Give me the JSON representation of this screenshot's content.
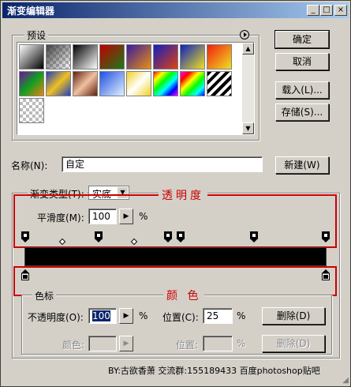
{
  "window": {
    "title": "渐变编辑器",
    "controls": [
      "_",
      "□",
      "×"
    ]
  },
  "presets": {
    "legend": "预设",
    "menu_icon": "circle-arrow-right-icon"
  },
  "buttons": {
    "ok": "确定",
    "cancel": "取消",
    "load": "载入(L)...",
    "save": "存储(S)..."
  },
  "name_row": {
    "label": "名称(N):",
    "value": "自定",
    "new_button": "新建(W)"
  },
  "gradient_type": {
    "label": "渐变类型(T):",
    "value": "实底"
  },
  "smoothness": {
    "label": "平滑度(M):",
    "value": "100",
    "unit": "%"
  },
  "annotations": {
    "transparency": "透明度",
    "color": "颜 色"
  },
  "stops_group": {
    "legend": "色标",
    "opacity_label": "不透明度(O):",
    "opacity_value": "100",
    "opacity_unit": "%",
    "location_label_1": "位置(C):",
    "location_value_1": "25",
    "location_unit_1": "%",
    "delete_1": "删除(D)",
    "color_label": "颜色:",
    "location_label_2": "位置:",
    "location_unit_2": "%",
    "delete_2": "删除(D)"
  },
  "footer": {
    "credit": "BY:古欲香萧   交流群:155189433   百度photoshop贴吧"
  },
  "colors": {
    "title_start": "#0a246a",
    "title_end": "#a6caf0",
    "annotation_red": "#cc0000",
    "gradient": "#000000"
  }
}
